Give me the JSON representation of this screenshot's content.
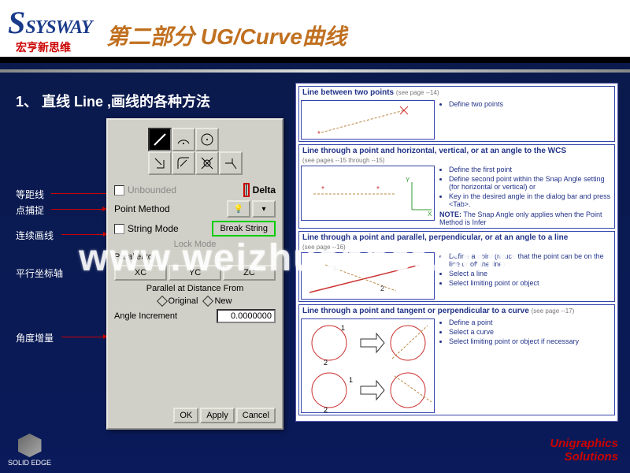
{
  "header": {
    "logo_main": "SYSWAY",
    "logo_s": "S",
    "logo_sub": "宏亨新思维",
    "title": "第二部分  UG/Curve曲线"
  },
  "subtitle": "1、 直线 Line ,画线的各种方法",
  "labels": {
    "eq_line": "等距线",
    "point_snap": "点捕捉",
    "cont_line": "连续画线",
    "parallel_axis": "平行坐标轴",
    "angle_inc": "角度增量"
  },
  "dialog": {
    "unbounded": "Unbounded",
    "delta": "Delta",
    "point_method": "Point Method",
    "string_mode": "String Mode",
    "break_string": "Break String",
    "lock_mode": "Lock Mode",
    "parallel_to": "Parallel to",
    "xc": "XC",
    "yc": "YC",
    "zc": "ZC",
    "parallel_dist": "Parallel at Distance From",
    "original": "Original",
    "new": "New",
    "angle_increment": "Angle Increment",
    "angle_value": "0.0000000",
    "ok": "OK",
    "apply": "Apply",
    "cancel": "Cancel"
  },
  "ref": {
    "s1": {
      "title": "Line between two points",
      "pg": "(see page --14)",
      "items": [
        "Define two points"
      ]
    },
    "s2": {
      "title": "Line through a point and horizontal, vertical, or at an angle to the WCS",
      "pg": "(see pages --15 through --15)",
      "items": [
        "Define the first point",
        "Define second point within the Snap Angle setting (for horizontal or vertical) or",
        "Key in the desired angle in the dialog bar and press <Tab>."
      ],
      "note_label": "NOTE:",
      "note": "The Snap Angle only applies when the Point Method is Infer"
    },
    "s3": {
      "title": "Line through a point and parallel, perpendicular, or at an angle to a line",
      "pg": "(see page --16)",
      "items": [
        "Define a point (notice that the point can be on the line or off the line)",
        "Select a line",
        "Select limiting point or object"
      ]
    },
    "s4": {
      "title": "Line through a point and tangent or perpendicular to a curve",
      "pg": "(see page --17)",
      "items": [
        "Define a point",
        "Select a curve",
        "Select limiting point or object if necessary"
      ]
    }
  },
  "footer": {
    "solid_edge": "SOLID EDGE",
    "ug1": "Unigraphics",
    "ug2": "Solutions"
  },
  "watermark": "www.weizhuannet.com"
}
